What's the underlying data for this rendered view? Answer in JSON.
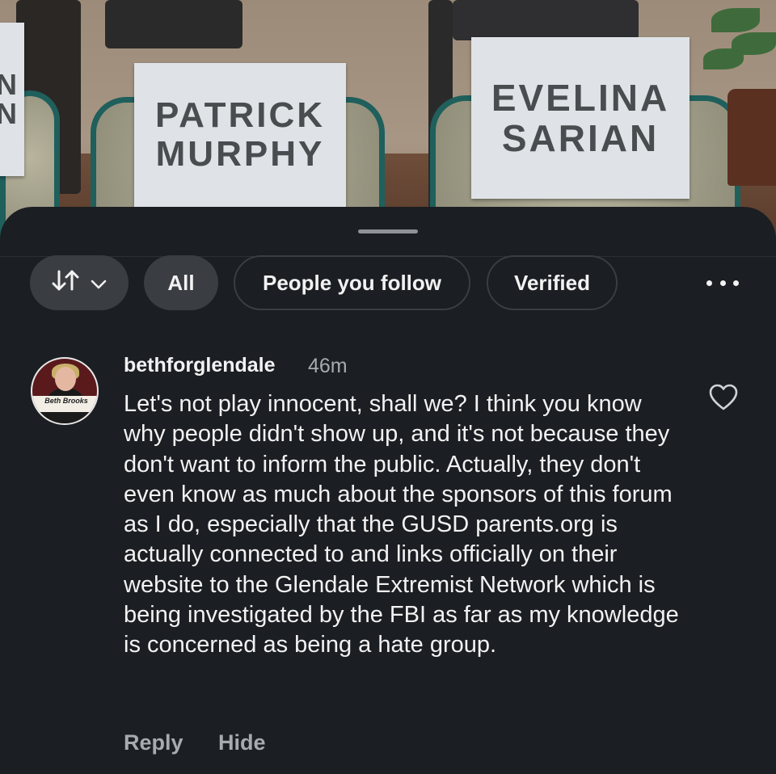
{
  "background": {
    "namecards": [
      {
        "lines": [
          "PATRICK",
          "MURPHY"
        ]
      },
      {
        "lines": [
          "EVELINA",
          "SARIAN"
        ]
      }
    ],
    "partial_card_letters": [
      "N",
      "N"
    ]
  },
  "filters": {
    "sort_icon": "sort-arrows-icon",
    "chips": [
      "All",
      "People you follow",
      "Verified"
    ],
    "selected": "All"
  },
  "comment": {
    "avatar_text": "Beth Brooks",
    "username": "bethforglendale",
    "time": "46m",
    "text": "Let's not play innocent, shall we? I think you know why people didn't show up, and it's not because they don't want to inform the public. Actually, they don't even know as much about the sponsors of this forum as I do, especially that the GUSD parents.org is actually connected to and links officially on their website to the Glendale Extremist Network which is being investigated by the FBI as far as my knowledge is concerned as being a hate group.",
    "actions": {
      "reply": "Reply",
      "hide": "Hide"
    }
  },
  "colors": {
    "sheet_bg": "#1b1e22",
    "chip_active": "#3a3d42",
    "text_primary": "#f2f2f2",
    "text_secondary": "#a7abb0"
  }
}
